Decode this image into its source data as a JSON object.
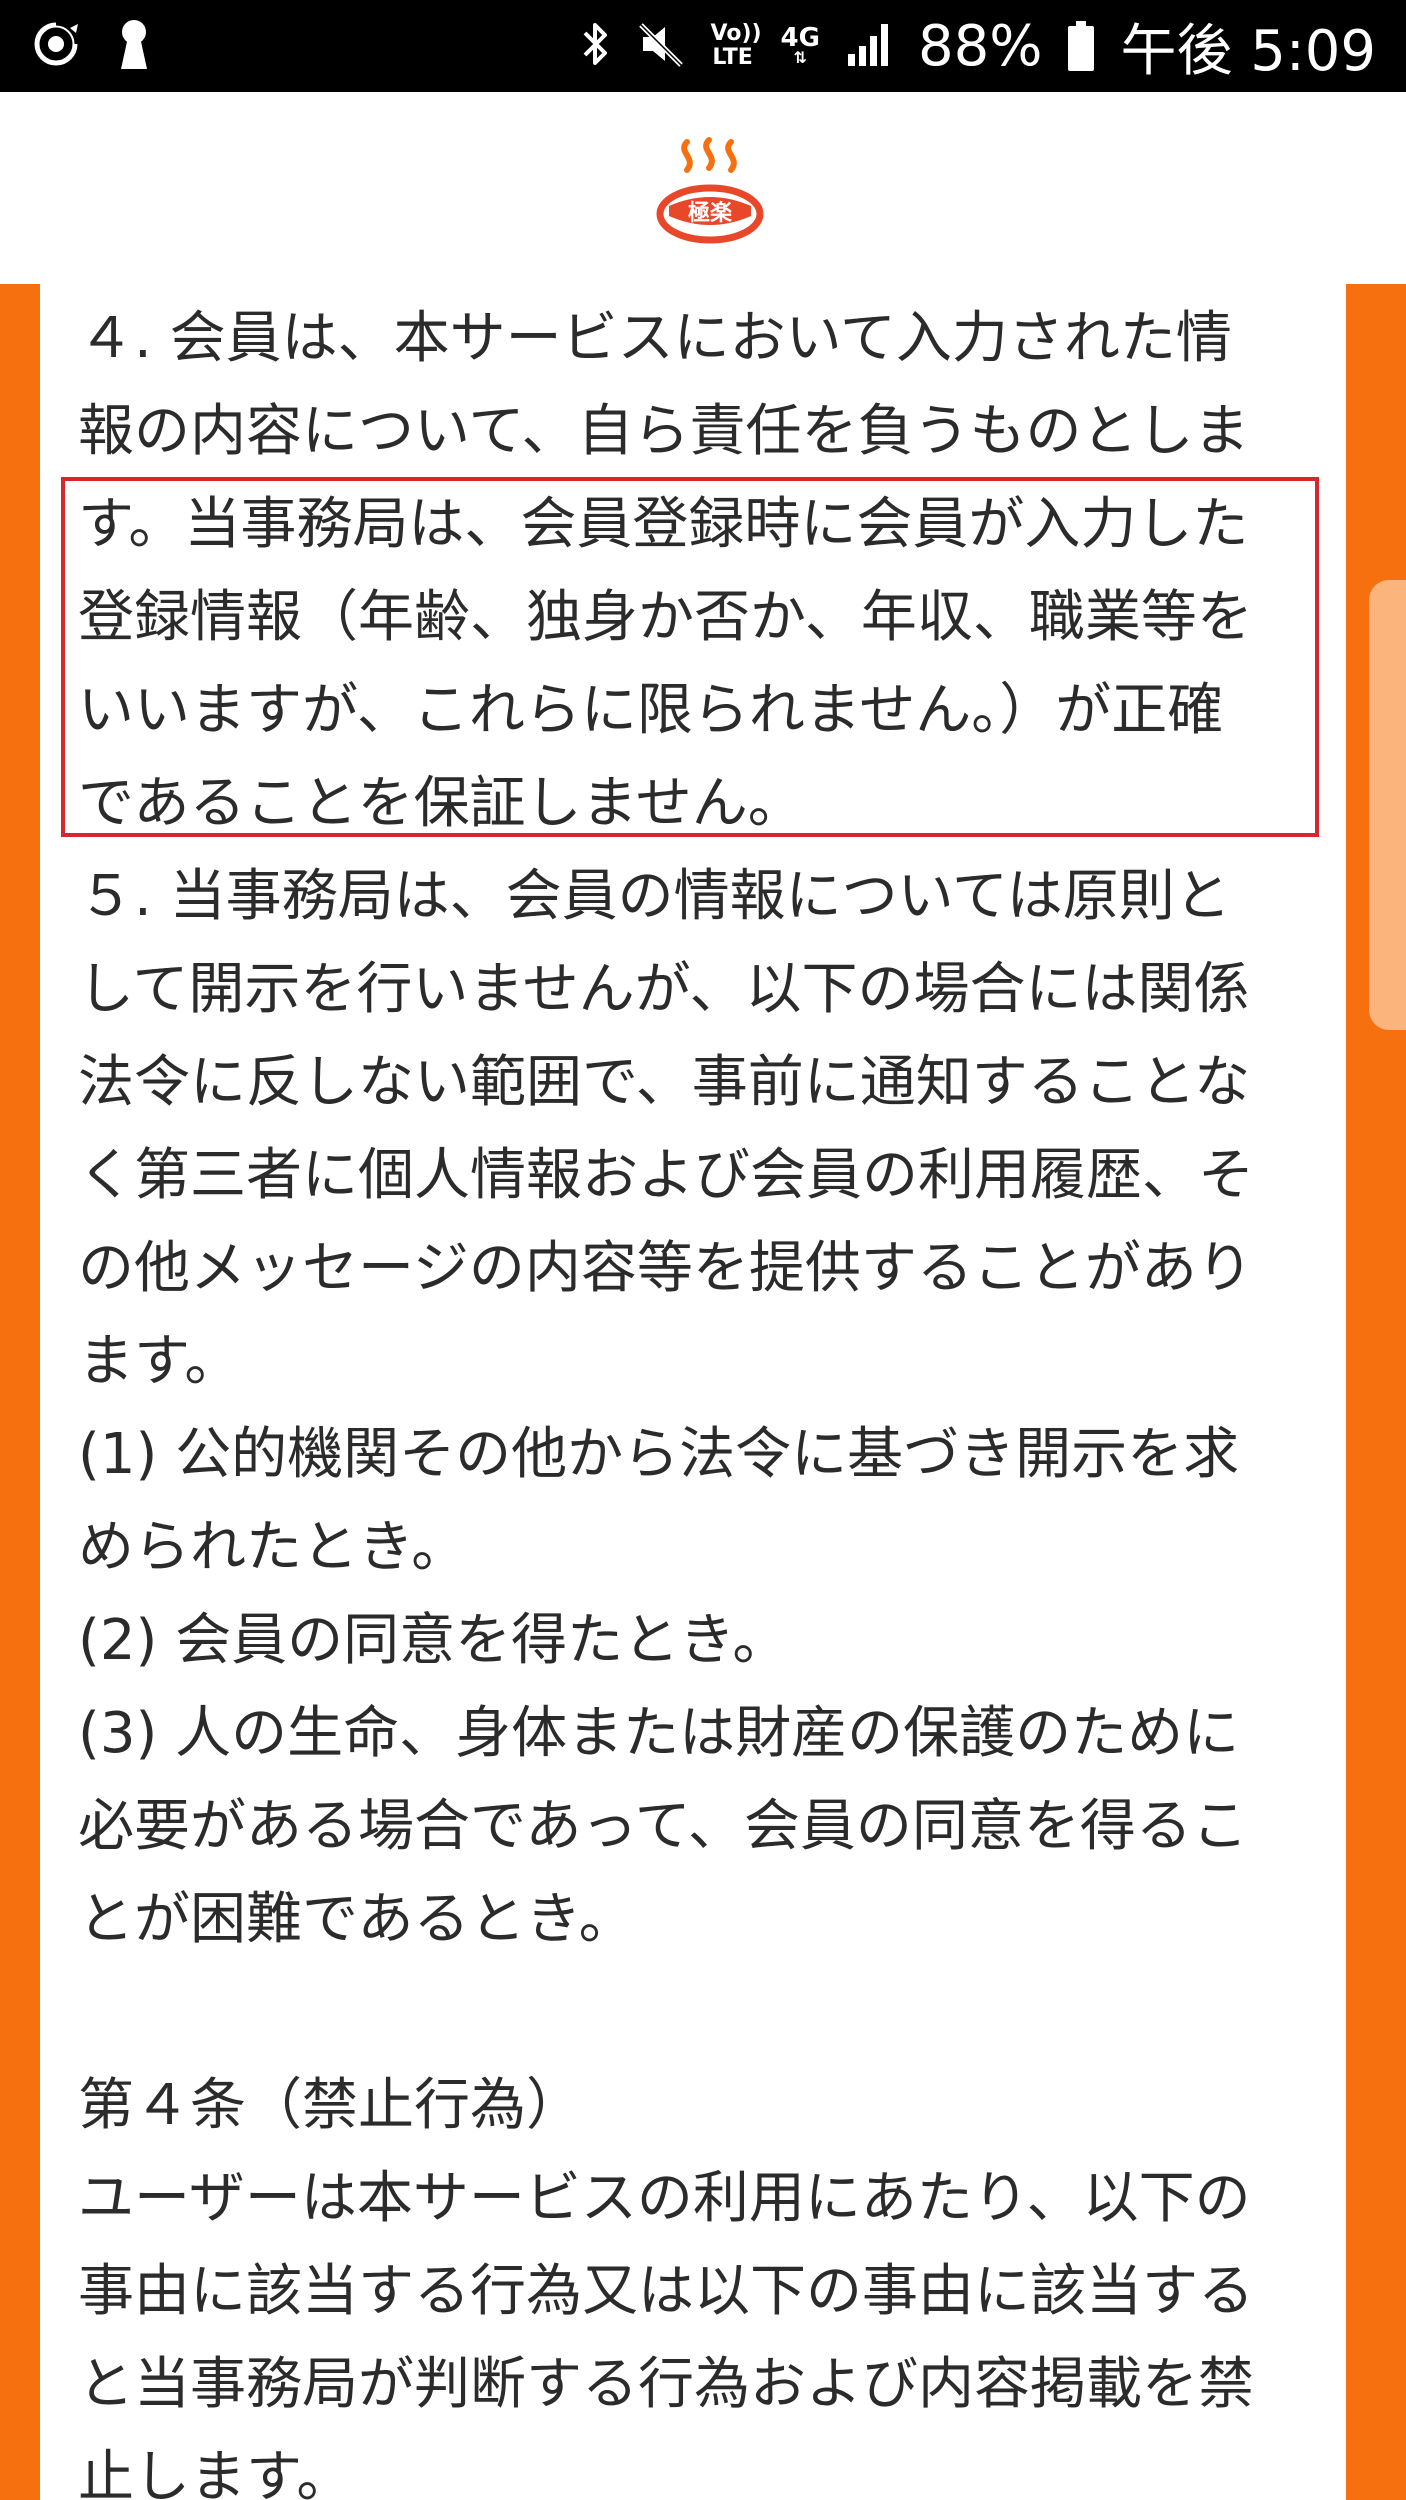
{
  "status_bar": {
    "left_icons": [
      "sync-icon",
      "keyhole-icon"
    ],
    "right_icons": [
      "bluetooth-icon",
      "mute-icon",
      "volte-icon",
      "4g-icon",
      "signal-icon",
      "battery-icon"
    ],
    "volte_label": "Vo)) LTE",
    "network_label": "4G",
    "battery": "88%",
    "time": "午後 5:09"
  },
  "header": {
    "logo_text": "極楽",
    "brand_color": "#f7700f"
  },
  "frame": {
    "accent_color": "#f7700f",
    "highlight_color": "#d7262d"
  },
  "article": {
    "lines": [
      "４. 会員は、本サービスにおいて入力された情",
      "報の内容について、自ら責任を負うものとしま",
      "す。当事務局は、会員登録時に会員が入力した",
      "登録情報（年齢、独身か否か、年収、職業等を",
      "いいますが、これらに限られません。）が正確",
      "であることを保証しません。",
      "５. 当事務局は、会員の情報については原則と",
      "して開示を行いませんが、以下の場合には関係",
      "法令に反しない範囲で、事前に通知することな",
      "く第三者に個人情報および会員の利用履歴、そ",
      "の他メッセージの内容等を提供することがあり",
      "ます。",
      "(1) 公的機関その他から法令に基づき開示を求",
      "められたとき。",
      "(2) 会員の同意を得たとき。",
      "(3) 人の生命、身体または財産の保護のために",
      "必要がある場合であって、会員の同意を得るこ",
      "とが困難であるとき。",
      "",
      "第４条（禁止行為）",
      "ユーザーは本サービスの利用にあたり、以下の",
      "事由に該当する行為又は以下の事由に該当する",
      "と当事務局が判断する行為および内容掲載を禁",
      "止します。"
    ]
  }
}
